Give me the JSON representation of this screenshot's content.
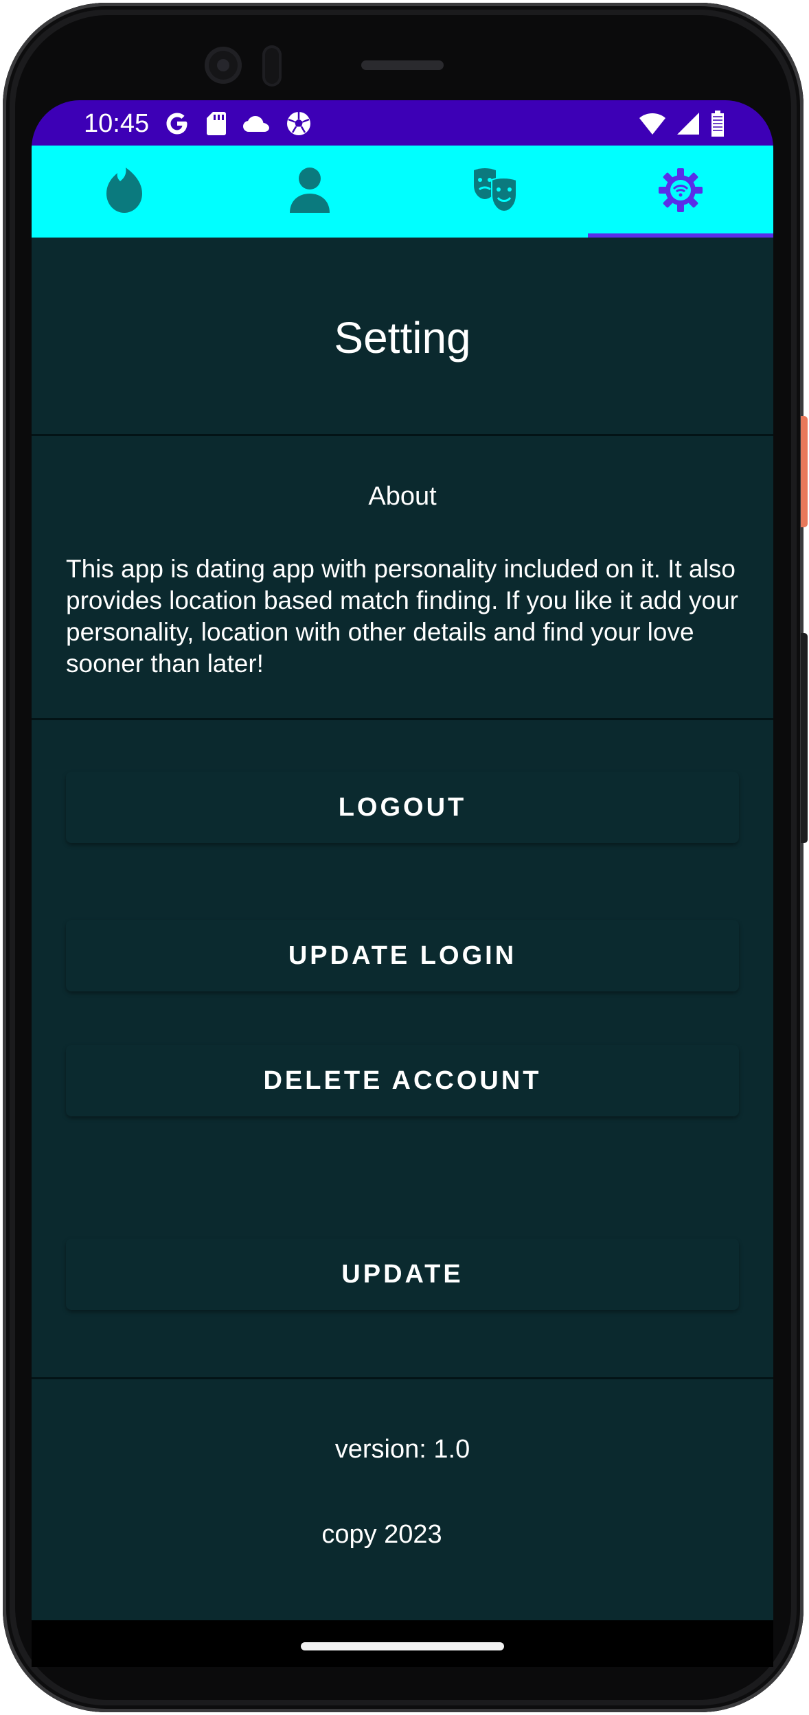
{
  "status_bar": {
    "time": "10:45",
    "left_icons": [
      "google-icon",
      "sd-card-icon",
      "cloud-icon",
      "soccer-ball-icon"
    ],
    "right_icons": [
      "wifi-icon",
      "cell-signal-icon",
      "battery-icon"
    ],
    "background": "#3d00b6"
  },
  "tabs": {
    "background": "#00ffff",
    "items": [
      {
        "icon": "flame-icon",
        "selected": false
      },
      {
        "icon": "person-icon",
        "selected": false
      },
      {
        "icon": "theater-masks-icon",
        "selected": false
      },
      {
        "icon": "settings-gear-icon",
        "selected": true
      }
    ],
    "inactive_color": "#0b7a7e",
    "active_color": "#5a2ee8"
  },
  "page": {
    "title": "Setting",
    "background": "#0b292e"
  },
  "about": {
    "heading": "About",
    "text": "This app is dating app with personality included on it. It also provides location based match finding. If you like it add your personality, location  with other details and find your love sooner than later!"
  },
  "buttons": {
    "logout": "LOGOUT",
    "update_login": "UPDATE LOGIN",
    "delete_account": "DELETE ACCOUNT",
    "update": "UPDATE"
  },
  "footer": {
    "version": "version: 1.0",
    "copy": "copy 2023"
  }
}
